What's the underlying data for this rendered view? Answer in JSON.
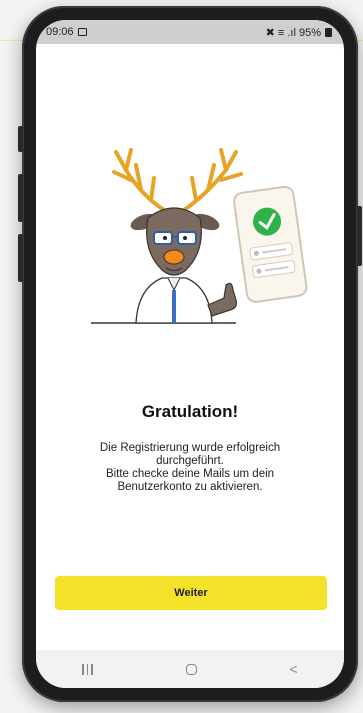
{
  "status_bar": {
    "time": "09:06",
    "right_text": "✖ ≡ .ıl 95%"
  },
  "main": {
    "title": "Gratulation!",
    "message_line1": "Die Registrierung wurde erfolgreich",
    "message_line2": "durchgeführt.",
    "message_line3": "Bitte checke deine Mails um dein",
    "message_line4": "Benutzerkonto zu aktivieren."
  },
  "cta": {
    "label": "Weiter"
  },
  "nav": {
    "back_glyph": "<"
  },
  "colors": {
    "accent": "#f5e22a",
    "check_green": "#2db34a",
    "antler": "#e6a427",
    "nose": "#f08a1c"
  },
  "icons": [
    "image-icon",
    "battery-icon",
    "reindeer-illustration",
    "phone-check-icon",
    "recent-apps-icon",
    "home-icon",
    "back-icon"
  ]
}
